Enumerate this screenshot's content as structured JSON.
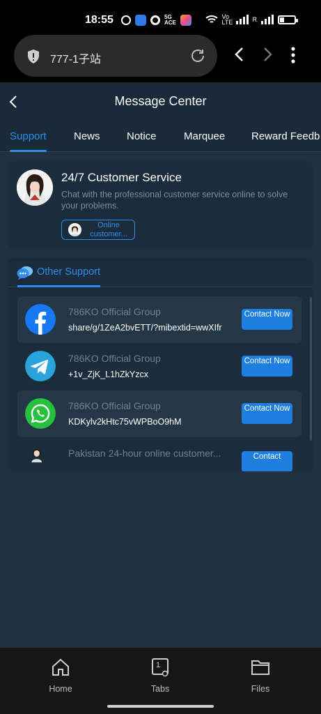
{
  "status_bar": {
    "time": "18:55",
    "network_label": "Vo LTE",
    "sim_label": "R"
  },
  "browser": {
    "url": "777-1子站"
  },
  "header": {
    "title": "Message Center"
  },
  "tabs": [
    {
      "label": "Support",
      "active": true
    },
    {
      "label": "News",
      "active": false
    },
    {
      "label": "Notice",
      "active": false
    },
    {
      "label": "Marquee",
      "active": false
    },
    {
      "label": "Reward Feedb",
      "active": false
    }
  ],
  "customer_service": {
    "title": "24/7 Customer Service",
    "description": "Chat with the professional customer service online to solve your problems.",
    "button_label": "Online customer..."
  },
  "other_support": {
    "title": "Other Support",
    "items": [
      {
        "icon": "facebook-icon",
        "name": "786KO Official Group",
        "value": "share/g/1ZeA2bvETT/?mibextid=wwXIfr",
        "button": "Contact Now",
        "shaded": true
      },
      {
        "icon": "telegram-icon",
        "name": "786KO Official Group",
        "value": "+1v_ZjK_L1hZkYzcx",
        "button": "Contact Now",
        "shaded": false
      },
      {
        "icon": "whatsapp-icon",
        "name": "786KO Official Group",
        "value": "KDKylv2kHtc75vWPBoO9hM",
        "button": "Contact Now",
        "shaded": true
      },
      {
        "icon": "agent-avatar-icon",
        "name": "Pakistan 24-hour online customer...",
        "value": "",
        "button": "Contact",
        "shaded": false
      }
    ]
  },
  "bottom_nav": {
    "home": "Home",
    "tabs": "Tabs",
    "tab_count": "1",
    "files": "Files"
  },
  "colors": {
    "accent": "#2d8ee8",
    "background": "#1f3040",
    "card": "#1b2d3d",
    "facebook": "#1877f2",
    "telegram": "#2aa3dc",
    "whatsapp": "#27c13d"
  }
}
